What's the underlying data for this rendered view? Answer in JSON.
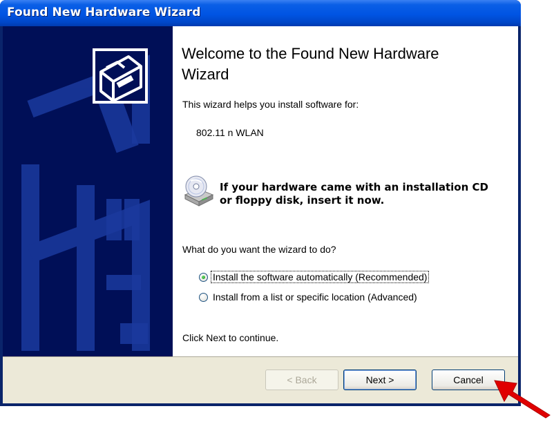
{
  "window": {
    "title": "Found New Hardware Wizard"
  },
  "main": {
    "heading": "Welcome to the Found New Hardware Wizard",
    "intro": "This wizard helps you install software for:",
    "device_name": "802.11 n WLAN",
    "cd_prompt_line1": "If your hardware came with an installation CD",
    "cd_prompt_line2": "or floppy disk, insert it now.",
    "question": "What do you want the wizard to do?",
    "options": [
      {
        "label": "Install the software automatically (Recommended)",
        "selected": true
      },
      {
        "label": "Install from a list or specific location (Advanced)",
        "selected": false
      }
    ],
    "continue_hint": "Click Next to continue."
  },
  "buttons": {
    "back": "< Back",
    "next": "Next >",
    "cancel": "Cancel"
  },
  "icons": {
    "banner": "hardware-box-icon",
    "cd": "cd-drive-icon",
    "annotation": "red-arrow-icon"
  },
  "colors": {
    "titlebar": "#0054e3",
    "banner_bg": "#000f57",
    "footer_bg": "#ece9d8",
    "annotation_arrow": "#e00000"
  }
}
